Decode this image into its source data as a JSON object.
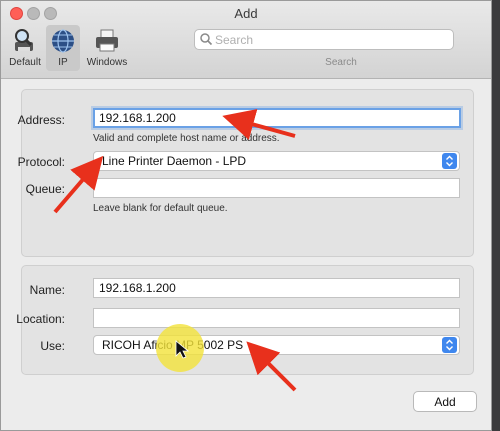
{
  "window": {
    "title": "Add"
  },
  "toolbar": {
    "tabs": [
      {
        "label": "Default",
        "icon": "magnifier-printer-icon"
      },
      {
        "label": "IP",
        "icon": "globe-icon",
        "selected": true
      },
      {
        "label": "Windows",
        "icon": "printer-icon"
      }
    ],
    "search": {
      "placeholder": "Search",
      "caption": "Search"
    }
  },
  "ip_section": {
    "address_label": "Address:",
    "address_value": "192.168.1.200",
    "address_hint": "Valid and complete host name or address.",
    "protocol_label": "Protocol:",
    "protocol_value": "Line Printer Daemon - LPD",
    "queue_label": "Queue:",
    "queue_value": "",
    "queue_hint": "Leave blank for default queue."
  },
  "details_section": {
    "name_label": "Name:",
    "name_value": "192.168.1.200",
    "location_label": "Location:",
    "location_value": "",
    "use_label": "Use:",
    "use_value": "RICOH Aficio MP 5002 PS"
  },
  "buttons": {
    "add_label": "Add"
  },
  "colors": {
    "annotation_arrow": "#e8301c",
    "cursor_highlight": "#f2e23a",
    "focus_ring": "#6aa1e6",
    "popup_accent": "#3f87ee"
  }
}
